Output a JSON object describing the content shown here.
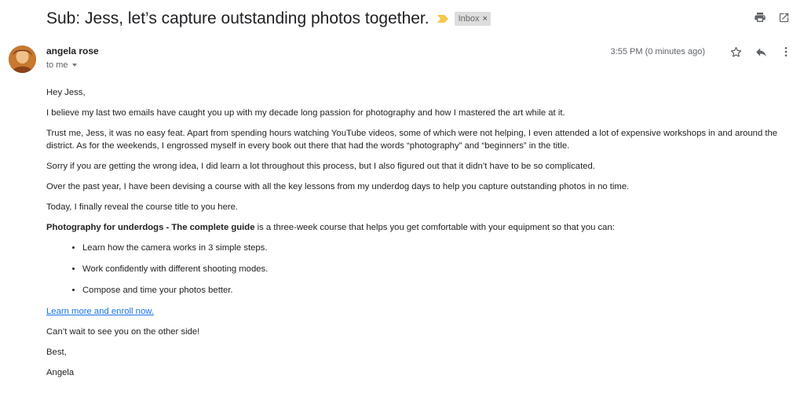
{
  "header": {
    "subject": "Sub: Jess, let’s capture outstanding photos together.",
    "label": "Inbox",
    "label_remove": "×",
    "icons": [
      "print-icon",
      "open-in-new-window-icon"
    ]
  },
  "sender": {
    "name": "angela rose",
    "to": "to me",
    "timestamp": "3:55 PM (0 minutes ago)"
  },
  "actions": {
    "icons": [
      "star-icon",
      "reply-icon",
      "more-options-icon"
    ]
  },
  "message": {
    "greeting": "Hey Jess,",
    "p1": "I believe my last two emails have caught you up with my decade long passion for photography and how I mastered the art while at it.",
    "p2": "Trust me, Jess, it was no easy feat. Apart from spending hours watching YouTube videos, some of which were not helping, I even attended a lot of expensive workshops in and around the district. As for the weekends, I  engrossed myself in every book out there that had the words “photography” and “beginners” in the title.",
    "p3": "Sorry if you are getting the wrong idea, I did learn a lot throughout this process, but I also figured out that it didn’t have to be so complicated.",
    "p4": "Over the past year, I have been devising a course with all the key lessons from my underdog days to help you capture outstanding photos in no time.",
    "p5": "Today, I finally reveal the course title to you here.",
    "course_title": "Photography for underdogs - The complete guide",
    "course_desc": " is a three-week course that helps you get comfortable with your equipment so that you can:",
    "bullets": [
      "Learn how the camera works in 3 simple steps.",
      "Work confidently with different shooting modes.",
      "Compose and time your photos better."
    ],
    "link": "Learn more and enroll now.",
    "closing": "Can’t wait to see you on the other side!",
    "signoff": "Best,",
    "signature": "Angela"
  },
  "colors": {
    "importance_marker": "#f2c94c",
    "link": "#1a73e8",
    "label_bg": "#dddddd"
  }
}
